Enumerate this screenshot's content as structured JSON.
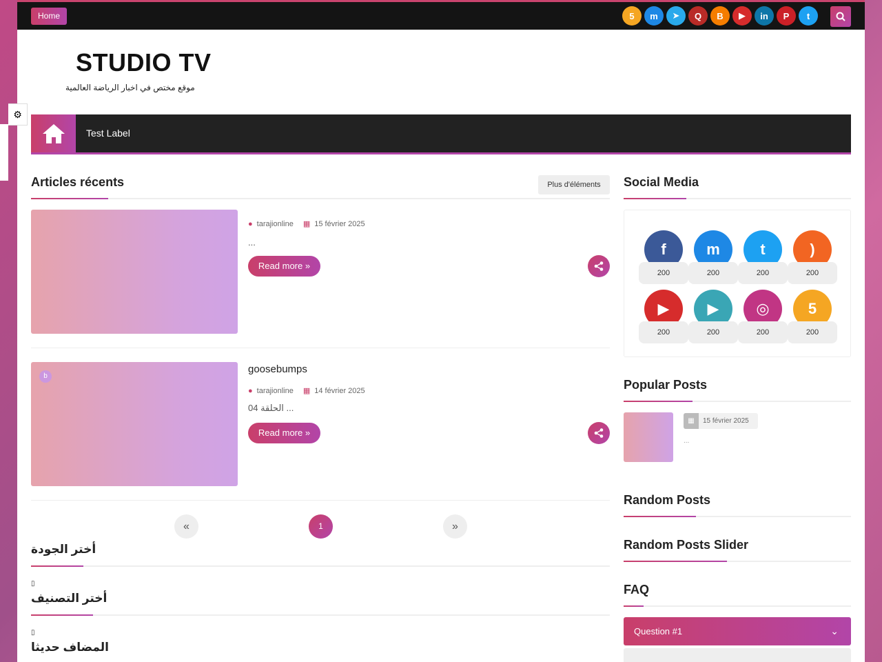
{
  "topbar": {
    "home_label": "Home",
    "social_icons": [
      {
        "name": "five-icon",
        "glyph": "5",
        "color": "#f5a623"
      },
      {
        "name": "messenger-icon",
        "glyph": "m",
        "color": "#1e88e5"
      },
      {
        "name": "telegram-icon",
        "glyph": "➤",
        "color": "#29a9eb"
      },
      {
        "name": "quora-icon",
        "glyph": "Q",
        "color": "#b92b27"
      },
      {
        "name": "blogger-icon",
        "glyph": "B",
        "color": "#f57d00"
      },
      {
        "name": "youtube-icon",
        "glyph": "▶",
        "color": "#d62c2c"
      },
      {
        "name": "linkedin-icon",
        "glyph": "in",
        "color": "#0e76a8"
      },
      {
        "name": "pinterest-icon",
        "glyph": "P",
        "color": "#cb2027"
      },
      {
        "name": "twitter-icon",
        "glyph": "t",
        "color": "#1da1f2"
      }
    ]
  },
  "header": {
    "site_title": "STUDIO TV",
    "site_description": "موقع مختص في اخبار الرياضة العالمية"
  },
  "nav": {
    "label": "Test Label"
  },
  "recent": {
    "title": "Articles récents",
    "more_label": "Plus d'éléments",
    "posts": [
      {
        "title": "",
        "author": "tarajionline",
        "date": "15 février 2025",
        "snippet": "...",
        "read_more": "Read more »",
        "badge": ""
      },
      {
        "title": "goosebumps",
        "author": "tarajionline",
        "date": "14 février 2025",
        "snippet": "الحلقة 04 ...",
        "read_more": "Read more »",
        "badge": "b"
      }
    ]
  },
  "pagination": {
    "prev": "«",
    "current": "1",
    "next": "»"
  },
  "arabic_sections": [
    {
      "title": "أختر الجودة"
    },
    {
      "title": "أختر التصنيف"
    },
    {
      "title": "المضاف حديثا"
    }
  ],
  "sidebar": {
    "social_title": "Social Media",
    "social_items": [
      {
        "name": "facebook-icon",
        "glyph": "f",
        "color": "#3b5998",
        "count": "200"
      },
      {
        "name": "messenger-icon",
        "glyph": "m",
        "color": "#1e88e5",
        "count": "200"
      },
      {
        "name": "twitter-icon",
        "glyph": "t",
        "color": "#1da1f2",
        "count": "200"
      },
      {
        "name": "rss-icon",
        "glyph": ")",
        "color": "#f26522",
        "count": "200"
      },
      {
        "name": "youtube-icon",
        "glyph": "▶",
        "color": "#d62c2c",
        "count": "200"
      },
      {
        "name": "google-play-icon",
        "glyph": "▶",
        "color": "#3aa6b5",
        "count": "200"
      },
      {
        "name": "instagram-icon",
        "glyph": "◎",
        "color": "#c13584",
        "count": "200"
      },
      {
        "name": "five-icon",
        "glyph": "5",
        "color": "#f5a623",
        "count": "200"
      }
    ],
    "popular_title": "Popular Posts",
    "popular_date": "15 février 2025",
    "popular_snippet": "...",
    "random_title": "Random Posts",
    "random_slider_title": "Random Posts Slider",
    "faq_title": "FAQ",
    "faq_question": "Question #1"
  }
}
